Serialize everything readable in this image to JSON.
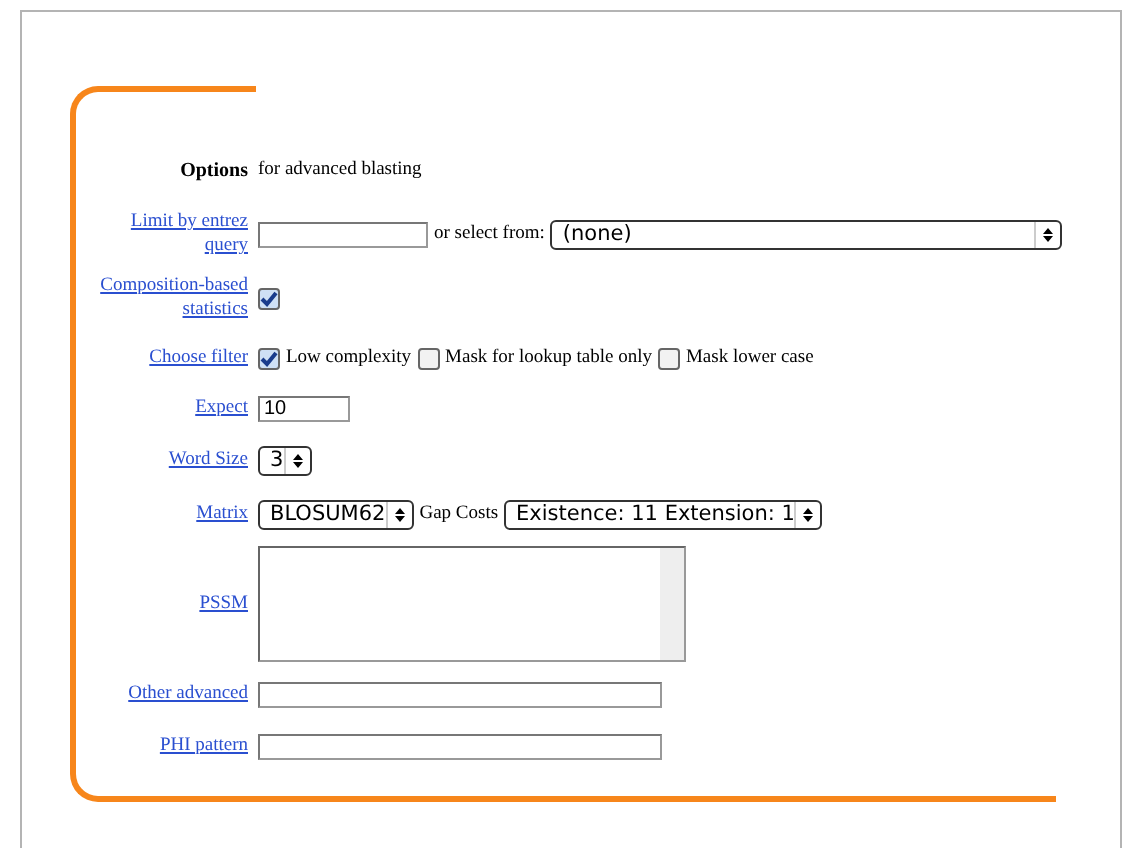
{
  "options": {
    "title": "Options",
    "subtitle": "for advanced blasting"
  },
  "fields": [
    {
      "kind": "entrez",
      "label": "Limit by entrez query",
      "connector": "or select from:",
      "select": "(none)"
    },
    {
      "kind": "checkbox",
      "label": "Composition-based statistics",
      "checked": true
    },
    {
      "kind": "filter",
      "label": "Choose filter",
      "options": [
        {
          "label": "Low complexity",
          "checked": true
        },
        {
          "label": "Mask for lookup table only",
          "checked": false
        },
        {
          "label": "Mask lower case",
          "checked": false
        }
      ]
    },
    {
      "kind": "short-text",
      "label": "Expect",
      "value": "10"
    },
    {
      "kind": "select",
      "label": "Word Size",
      "select": "3"
    },
    {
      "kind": "matrix",
      "label": "Matrix",
      "select": "BLOSUM62",
      "connector": "Gap Costs",
      "select2": "Existence: 11 Extension: 1"
    },
    {
      "kind": "textarea",
      "label": "PSSM"
    },
    {
      "kind": "text",
      "label": "Other advanced"
    },
    {
      "kind": "text",
      "label": "PHI pattern"
    }
  ]
}
